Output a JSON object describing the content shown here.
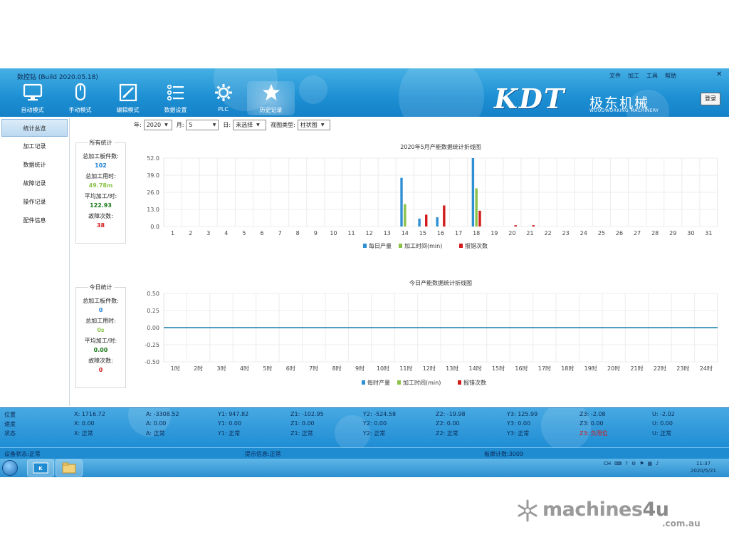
{
  "app": {
    "title": "数控钻 (Build 2020.05.18)",
    "menu": [
      "文件",
      "加工",
      "工具",
      "帮助"
    ],
    "close_glyph": "✕",
    "login_label": "登录"
  },
  "toolbar": [
    {
      "label": "自动模式",
      "icon": "monitor-icon"
    },
    {
      "label": "手动模式",
      "icon": "mouse-icon"
    },
    {
      "label": "编辑模式",
      "icon": "edit-icon"
    },
    {
      "label": "数据设置",
      "icon": "list-icon"
    },
    {
      "label": "PLC",
      "icon": "gear-icon"
    },
    {
      "label": "历史记录",
      "icon": "star-icon"
    }
  ],
  "toolbar_active": 5,
  "logo": {
    "brand": "KDT",
    "chinese": "极东机械",
    "english": "WOODWORKING MACHINERY"
  },
  "sidebar": {
    "items": [
      "统计总览",
      "加工记录",
      "数据统计",
      "故障记录",
      "操作记录",
      "配件信息"
    ],
    "active": 0
  },
  "filters": {
    "year_label": "年:",
    "year_value": "2020",
    "month_label": "月:",
    "month_value": "5",
    "day_label": "日:",
    "day_value": "未选择",
    "view_label": "视图类型:",
    "view_value": "柱状图"
  },
  "all_stats": {
    "title": "所有统计",
    "items": [
      {
        "label": "总加工板件数:",
        "value": "102",
        "color": "#1e7fd6"
      },
      {
        "label": "总加工用时:",
        "value": "49.78m",
        "color": "#8bc34a"
      },
      {
        "label": "平均加工/时:",
        "value": "122.93",
        "color": "#1b7a1b"
      },
      {
        "label": "故障次数:",
        "value": "38",
        "color": "#d21b1b"
      }
    ]
  },
  "today_stats": {
    "title": "今日统计",
    "items": [
      {
        "label": "总加工板件数:",
        "value": "0",
        "color": "#1e7fd6"
      },
      {
        "label": "总加工用时:",
        "value": "0s",
        "color": "#8bc34a"
      },
      {
        "label": "平均加工/时:",
        "value": "0.00",
        "color": "#1b7a1b"
      },
      {
        "label": "故障次数:",
        "value": "0",
        "color": "#d21b1b"
      }
    ]
  },
  "chart_data": [
    {
      "type": "bar",
      "title": "2020年5月产能数据统计折线图",
      "categories": [
        "1",
        "2",
        "3",
        "4",
        "5",
        "6",
        "7",
        "8",
        "9",
        "10",
        "11",
        "12",
        "13",
        "14",
        "15",
        "16",
        "17",
        "18",
        "19",
        "20",
        "21",
        "22",
        "23",
        "24",
        "25",
        "26",
        "27",
        "28",
        "29",
        "30",
        "31"
      ],
      "series": [
        {
          "name": "每日产量",
          "color": "#2e8fd3",
          "values": [
            0,
            0,
            0,
            0,
            0,
            0,
            0,
            0,
            0,
            0,
            0,
            0,
            0,
            37,
            6,
            7,
            0,
            52,
            0,
            0,
            0,
            0,
            0,
            0,
            0,
            0,
            0,
            0,
            0,
            0,
            0
          ]
        },
        {
          "name": "加工时间(min)",
          "color": "#8bc34a",
          "values": [
            0,
            0,
            0,
            0,
            0,
            0,
            0,
            0,
            0,
            0,
            0,
            0,
            0,
            17,
            0,
            0,
            0,
            29,
            0,
            0,
            0,
            0,
            0,
            0,
            0,
            0,
            0,
            0,
            0,
            0,
            0
          ]
        },
        {
          "name": "报错次数",
          "color": "#d21b1b",
          "values": [
            0,
            0,
            0,
            0,
            0,
            0,
            0,
            0,
            0,
            0,
            0,
            0,
            0,
            0,
            9,
            16,
            0,
            12,
            0,
            1,
            1,
            0,
            0,
            0,
            0,
            0,
            0,
            0,
            0,
            0,
            0
          ]
        }
      ],
      "yticks": [
        "0.0",
        "13.0",
        "26.0",
        "39.0",
        "52.0"
      ],
      "ylim": [
        0,
        52
      ],
      "grid": true,
      "legend": "bottom"
    },
    {
      "type": "line",
      "title": "今日产能数据统计折线图",
      "categories": [
        "1时",
        "2时",
        "3时",
        "4时",
        "5时",
        "6时",
        "7时",
        "8时",
        "9时",
        "10时",
        "11时",
        "12时",
        "13时",
        "14时",
        "15时",
        "16时",
        "17时",
        "18时",
        "19时",
        "20时",
        "21时",
        "22时",
        "23时",
        "24时"
      ],
      "series": [
        {
          "name": "每时产量",
          "color": "#2e8fd3",
          "values": [
            0,
            0,
            0,
            0,
            0,
            0,
            0,
            0,
            0,
            0,
            0,
            0,
            0,
            0,
            0,
            0,
            0,
            0,
            0,
            0,
            0,
            0,
            0,
            0
          ]
        },
        {
          "name": "加工时间(min)",
          "color": "#8bc34a",
          "values": [
            0,
            0,
            0,
            0,
            0,
            0,
            0,
            0,
            0,
            0,
            0,
            0,
            0,
            0,
            0,
            0,
            0,
            0,
            0,
            0,
            0,
            0,
            0,
            0
          ]
        },
        {
          "name": "报错次数",
          "color": "#c9935a",
          "values": [
            0,
            0,
            0,
            0,
            0,
            0,
            0,
            0,
            0,
            0,
            0,
            0,
            0,
            0,
            0,
            0,
            0,
            0,
            0,
            0,
            0,
            0,
            0,
            0
          ]
        }
      ],
      "legend_colors": [
        "#2e8fd3",
        "#8bc34a",
        "#d21b1b"
      ],
      "yticks": [
        "-0.50",
        "-0.25",
        "0.00",
        "0.25",
        "0.50"
      ],
      "ylim": [
        -0.5,
        0.5
      ],
      "grid": true,
      "legend": "bottom"
    }
  ],
  "status": {
    "row_labels": [
      "位置",
      "速度",
      "状态"
    ],
    "rows": [
      [
        "X: 1716.72",
        "A: -3308.52",
        "Y1: 947.82",
        "Z1: -102.95",
        "Y2: -524.58",
        "Z2: -19.98",
        "Y3: 125.99",
        "Z3: -2.08",
        "U: -2.02"
      ],
      [
        "X: 0.00",
        "A: 0.00",
        "Y1: 0.00",
        "Z1: 0.00",
        "Y2: 0.00",
        "Z2: 0.00",
        "Y3: 0.00",
        "Z3: 0.00",
        "U: 0.00"
      ],
      [
        "X: 正常",
        "A: 正常",
        "Y1: 正常",
        "Z1: 正常",
        "Y2: 正常",
        "Z2: 正常",
        "Y3: 正常",
        "Z3: 负限位",
        "U: 正常"
      ]
    ],
    "warn_cell": [
      2,
      7
    ],
    "device_status": "设备状态:正常",
    "hint": "提示信息:正常",
    "count": "板摩计数:3009"
  },
  "taskbar": {
    "tray_lang": "CH",
    "time": "11:37",
    "date": "2020/5/21"
  },
  "watermark": {
    "text_a": "machines",
    "text_b": "4u",
    "sub": ".com.au"
  }
}
